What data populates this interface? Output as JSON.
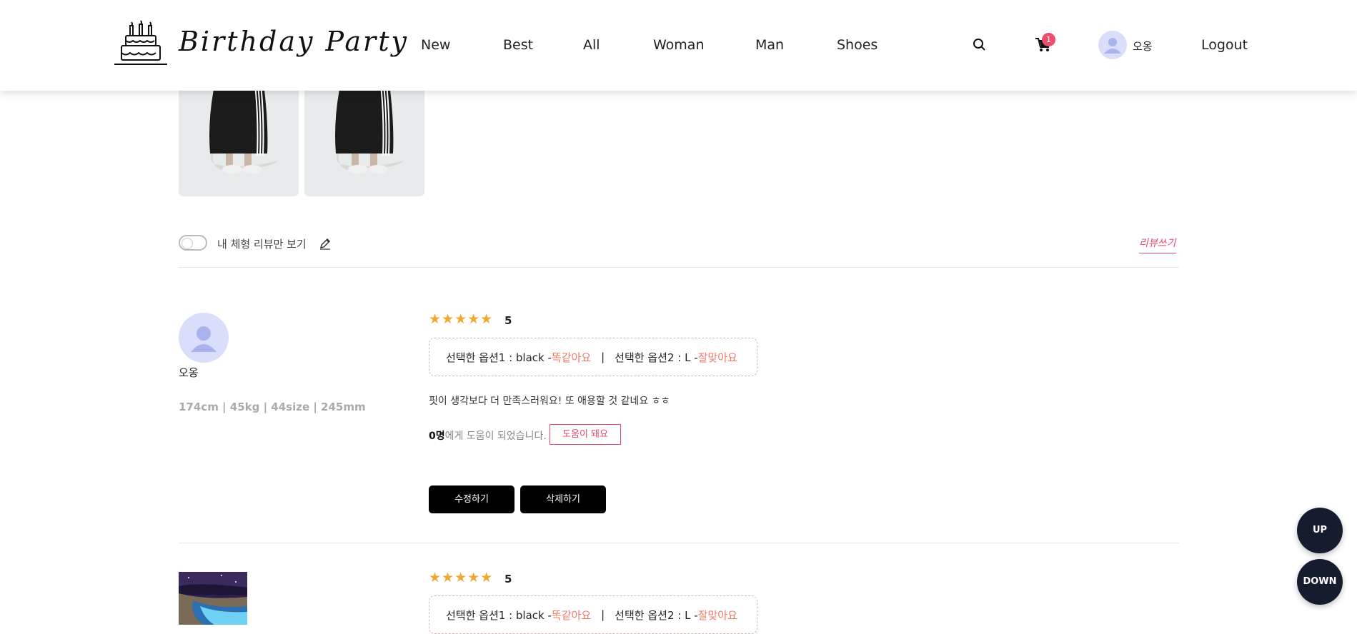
{
  "brand": {
    "name": "Birthday Party",
    "logo_icon": "birthday-cake-icon"
  },
  "nav": [
    "New",
    "Best",
    "All",
    "Woman",
    "Man",
    "Shoes"
  ],
  "header": {
    "search_icon": "search-icon",
    "cart_icon": "cart-icon",
    "cart_count": "1",
    "username": "오옹",
    "logout_label": "Logout"
  },
  "filter": {
    "toggle_label": "내 체형 리뷰만 보기",
    "pencil_icon": "pencil-icon",
    "write_review_label": "리뷰쓰기"
  },
  "reviews": [
    {
      "username": "오옹",
      "body_info": "174cm | 45kg | 44size | 245mm",
      "rating": "5",
      "option1_label": "선택한 옵션1 : black - ",
      "option1_fit": "똑같아요",
      "separator": "|",
      "option2_label": "선택한 옵션2 : L - ",
      "option2_fit": "잘맞아요",
      "text": "핏이 생각보다 더 만족스러워요! 또 애용할 것 같네요 ㅎㅎ",
      "helpful_count": "0명",
      "helpful_suffix": "에게 도움이 되었습니다.",
      "helpful_button": "도움이 돼요",
      "edit_label": "수정하기",
      "delete_label": "삭제하기"
    },
    {
      "rating": "5",
      "option1_label": "선택한 옵션1 : black - ",
      "option1_fit": "똑같아요",
      "separator": "|",
      "option2_label": "선택한 옵션2 : L - ",
      "option2_fit": "잘맞아요"
    }
  ],
  "floating": {
    "up_label": "UP",
    "down_label": "DOWN"
  },
  "colors": {
    "accent_pink": "#e8466b",
    "star": "#f0a830",
    "fit_red": "#f07a6a",
    "float_btn": "#151c2e"
  }
}
